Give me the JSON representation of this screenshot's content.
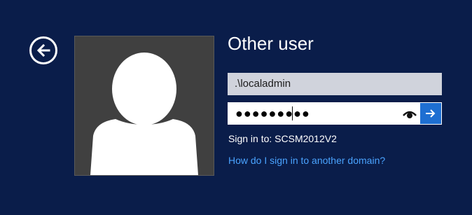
{
  "user": {
    "title": "Other user"
  },
  "form": {
    "username_value": ".\\localadmin",
    "password_masked": "●●●●●●●●●"
  },
  "sign_in": {
    "target_text": "Sign in to: SCSM2012V2"
  },
  "help": {
    "link_text": "How do I sign in to another domain?"
  },
  "icons": {
    "back": "back-arrow-icon",
    "avatar": "user-silhouette-icon",
    "reveal": "eye-icon",
    "submit": "right-arrow-icon"
  },
  "colors": {
    "background": "#0a1d4a",
    "avatar_tile": "#404040",
    "username_field": "#d0d3dc",
    "submit_button": "#1e6fd2",
    "link": "#4aa3ff"
  }
}
